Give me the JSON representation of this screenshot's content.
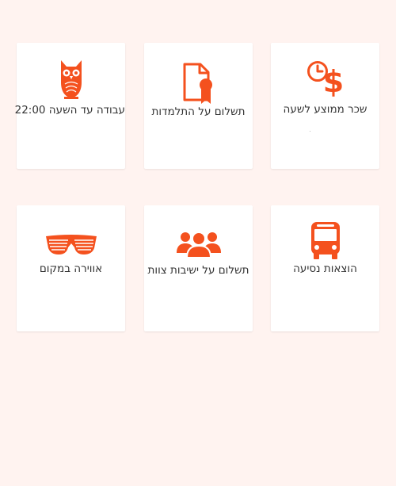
{
  "colors": {
    "background": "#fff3f0",
    "card": "#ffffff",
    "accent": "#f4511e",
    "text": "#333333"
  },
  "cards": [
    {
      "icon": "clock-dollar-icon",
      "label": "שכר ממוצע לשעה"
    },
    {
      "icon": "certificate-icon",
      "label": "תשלום על התלמדות"
    },
    {
      "icon": "owl-icon",
      "label": "עבודה עד השעה 22:00"
    },
    {
      "icon": "bus-icon",
      "label": "הוצאות נסיעה"
    },
    {
      "icon": "team-icon",
      "label": "תשלום על ישיבות צוות"
    },
    {
      "icon": "shutter-glasses-icon",
      "label": "אווירה במקום"
    }
  ]
}
